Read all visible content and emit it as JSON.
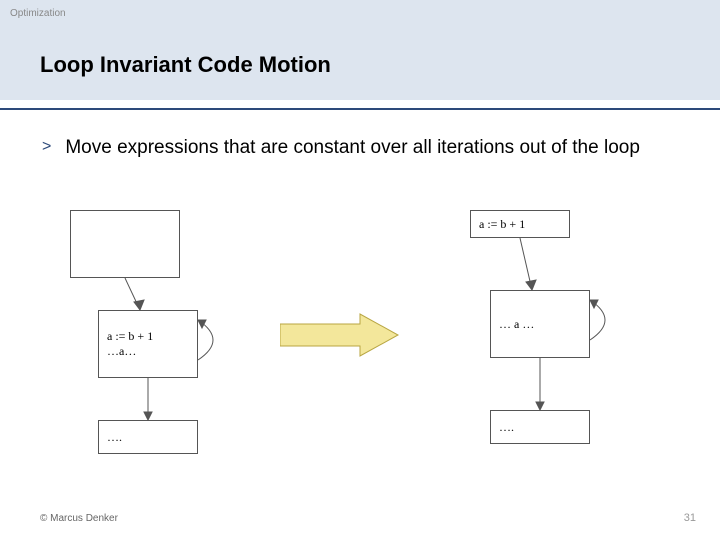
{
  "category": "Optimization",
  "title": "Loop Invariant Code Motion",
  "bullet": "Move expressions that are constant over all iterations out of the loop",
  "left_diagram": {
    "top_box": "",
    "mid_line1": "a := b + 1",
    "mid_line2": "…a…",
    "bot_box": "…."
  },
  "right_diagram": {
    "top_box": "a := b + 1",
    "mid_line1": "… a …",
    "bot_box": "…."
  },
  "footer": {
    "copyright": "© Marcus Denker",
    "page": "31"
  }
}
